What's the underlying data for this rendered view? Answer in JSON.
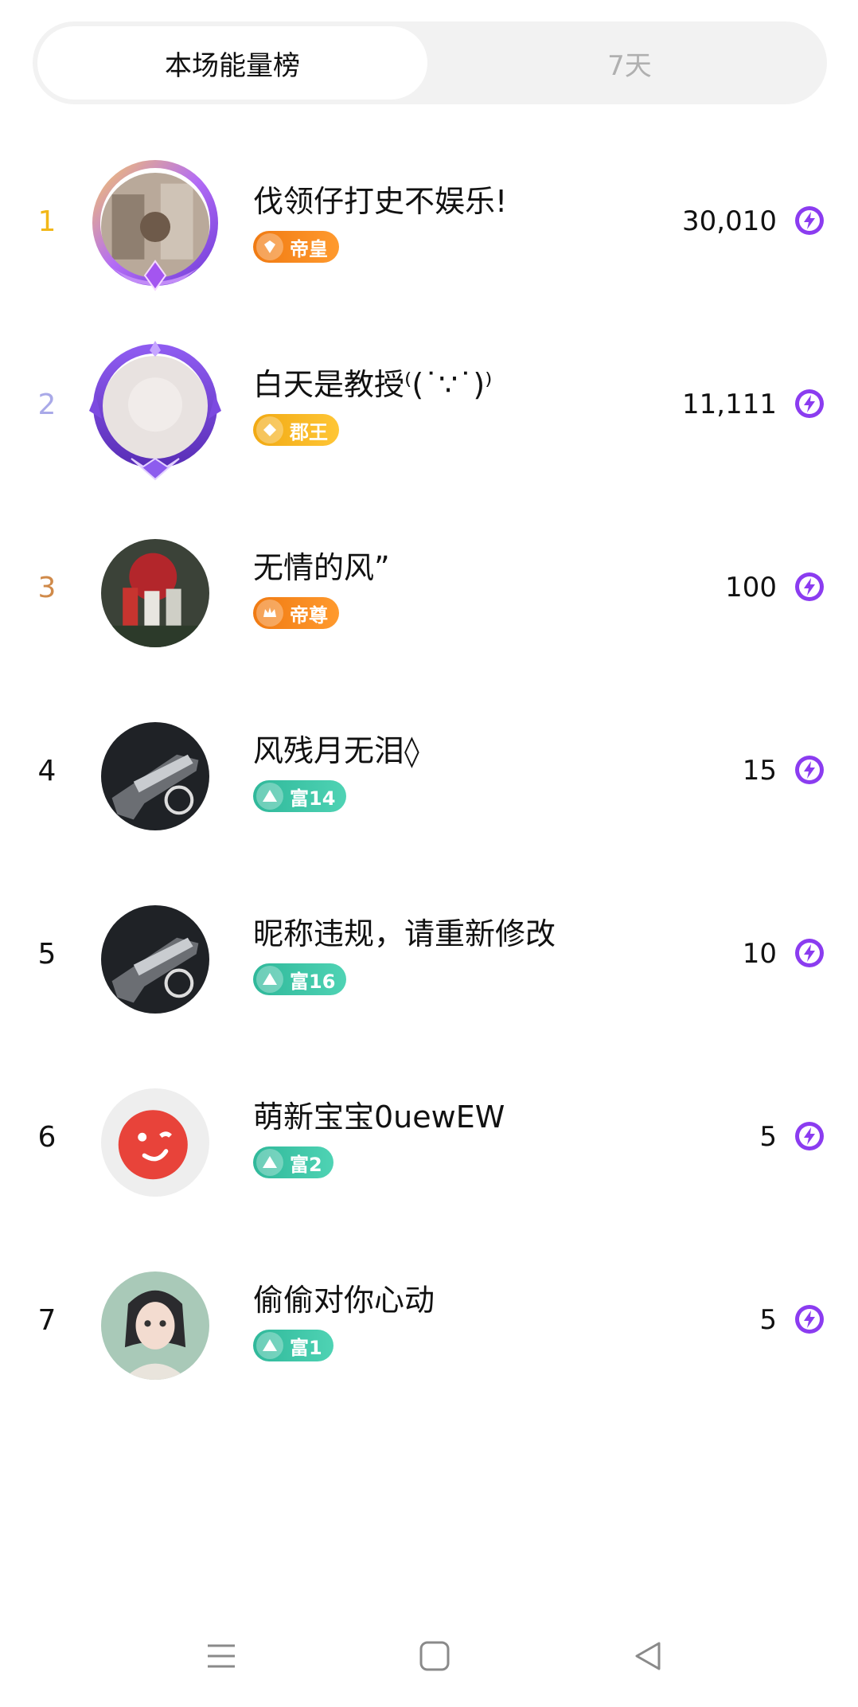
{
  "tabs": [
    {
      "label": "本场能量榜",
      "active": true
    },
    {
      "label": "7天",
      "active": false
    }
  ],
  "ranking": [
    {
      "rank": "1",
      "rank_color": "#f2b718",
      "name": "伐领仔打史不娱乐!",
      "badge": "帝皇",
      "badge_style": "orange",
      "score": "30,010",
      "frame": "purple-gold",
      "avatar": "photo-1"
    },
    {
      "rank": "2",
      "rank_color": "#a9a9e8",
      "name": "白天是教授⁽(˙∵˙)⁾",
      "badge": "郡王",
      "badge_style": "gold",
      "score": "11,111",
      "frame": "purple-crown",
      "avatar": "photo-2"
    },
    {
      "rank": "3",
      "rank_color": "#d08a4a",
      "name": "无情的风”",
      "badge": "帝尊",
      "badge_style": "orange",
      "score": "100",
      "frame": "none",
      "avatar": "football"
    },
    {
      "rank": "4",
      "rank_color": "#111111",
      "name": "风残月无泪◊",
      "badge": "富14",
      "badge_style": "teal",
      "score": "15",
      "frame": "none",
      "avatar": "pistol"
    },
    {
      "rank": "5",
      "rank_color": "#111111",
      "name": "昵称违规，请重新修改",
      "badge": "富16",
      "badge_style": "teal",
      "score": "10",
      "frame": "none",
      "avatar": "pistol"
    },
    {
      "rank": "6",
      "rank_color": "#111111",
      "name": "萌新宝宝0uewEW",
      "badge": "富2",
      "badge_style": "teal",
      "score": "5",
      "frame": "none",
      "avatar": "wink-face"
    },
    {
      "rank": "7",
      "rank_color": "#111111",
      "name": "偷偷对你心动",
      "badge": "富1",
      "badge_style": "teal",
      "score": "5",
      "frame": "none",
      "avatar": "anime-girl"
    }
  ],
  "icons": {
    "energy": "lightning-bolt-icon",
    "nav": [
      "menu-icon",
      "home-square-icon",
      "back-triangle-icon"
    ]
  },
  "colors": {
    "energy_purple": "#8b3cf0",
    "tab_bg": "#f2f2f2"
  }
}
